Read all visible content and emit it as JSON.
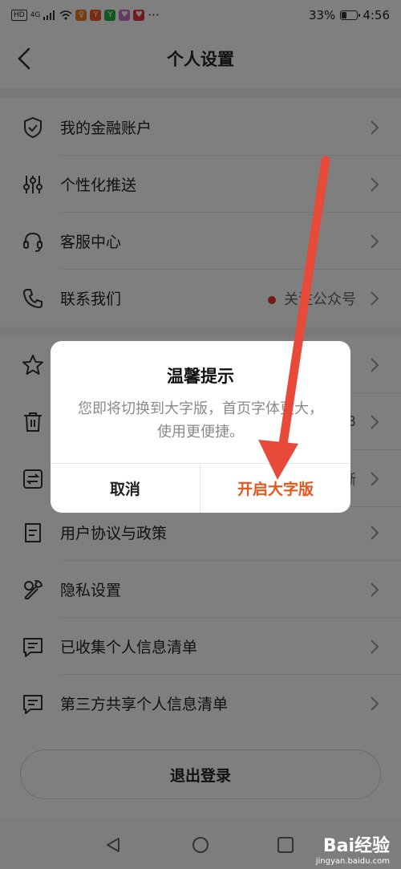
{
  "status_bar": {
    "hd": "HD",
    "network": "4G",
    "battery_text": "33%",
    "battery_level": 0.33,
    "time": "4:56",
    "more": "···"
  },
  "header": {
    "title": "个人设置"
  },
  "menu": {
    "group1": [
      {
        "label": "我的金融账户",
        "icon": "shield-icon"
      },
      {
        "label": "个性化推送",
        "icon": "sliders-icon"
      },
      {
        "label": "客服中心",
        "icon": "headset-icon"
      },
      {
        "label": "联系我们",
        "icon": "phone-icon",
        "extra": "关注公众号"
      }
    ],
    "group2": [
      {
        "label": "",
        "icon": "star-icon"
      },
      {
        "label": "",
        "icon": "trash-icon",
        "extra": "MB"
      },
      {
        "label": "",
        "icon": "switch-icon",
        "extra": "晰"
      },
      {
        "label": "用户协议与政策",
        "icon": "document-icon"
      },
      {
        "label": "隐私设置",
        "icon": "privacy-wrench-icon"
      },
      {
        "label": "已收集个人信息清单",
        "icon": "message-list-icon"
      },
      {
        "label": "第三方共享个人信息清单",
        "icon": "message-list-icon"
      }
    ]
  },
  "logout_label": "退出登录",
  "dialog": {
    "title": "温馨提示",
    "message": "您即将切换到大字版，首页字体更大，使用更便捷。",
    "cancel_label": "取消",
    "confirm_label": "开启大字版"
  },
  "watermark": {
    "logo": "Bai经验",
    "url": "jingyan.baidu.com"
  },
  "colors": {
    "accent": "#e8561e",
    "arrow": "#e84a3a",
    "dot": "#e53935"
  }
}
